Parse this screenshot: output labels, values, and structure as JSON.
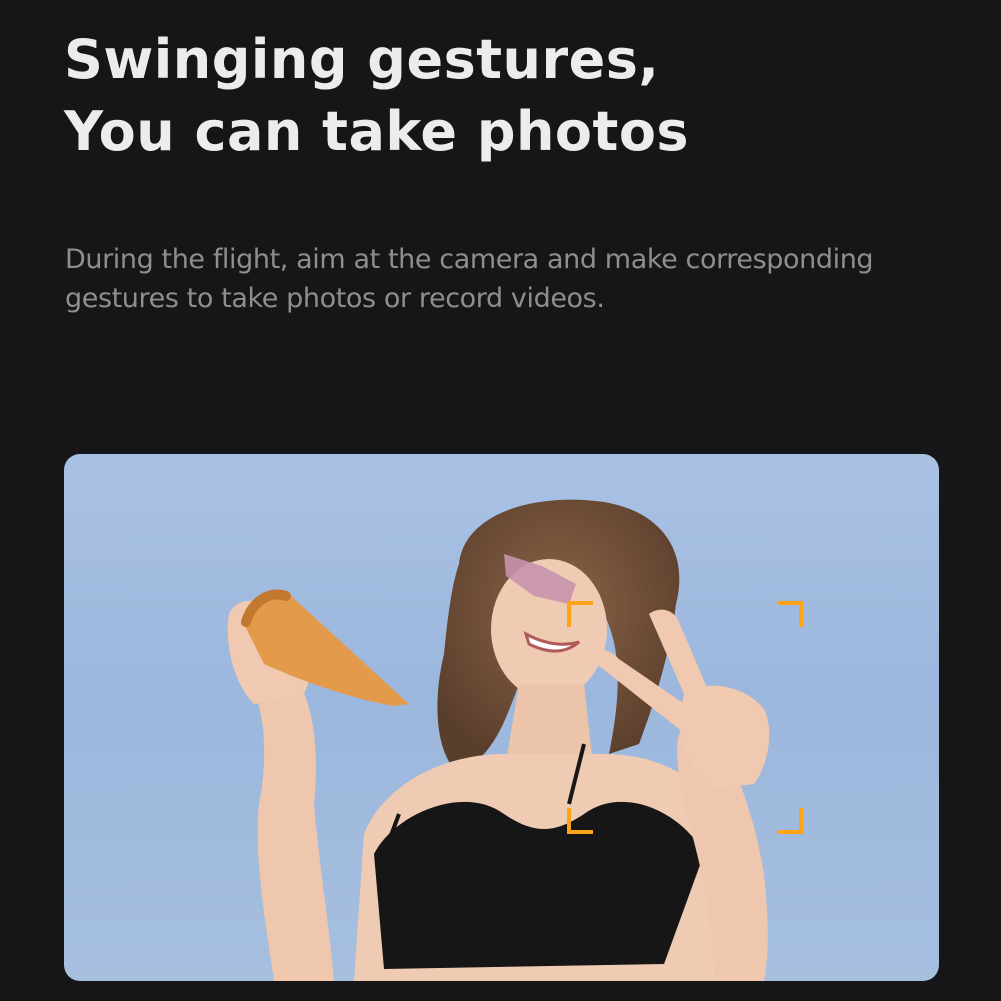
{
  "headline": {
    "line1": "Swinging gestures,",
    "line2": "You can take photos"
  },
  "description": {
    "line1": "During the flight, aim at the camera and make corresponding",
    "line2": "gestures to take photos or record videos."
  },
  "focus_frame": {
    "color": "#ffa21a"
  },
  "colors": {
    "background": "#161618",
    "headline": "#ececec",
    "description": "#8e8e90",
    "sky": "#a9c1e3"
  }
}
